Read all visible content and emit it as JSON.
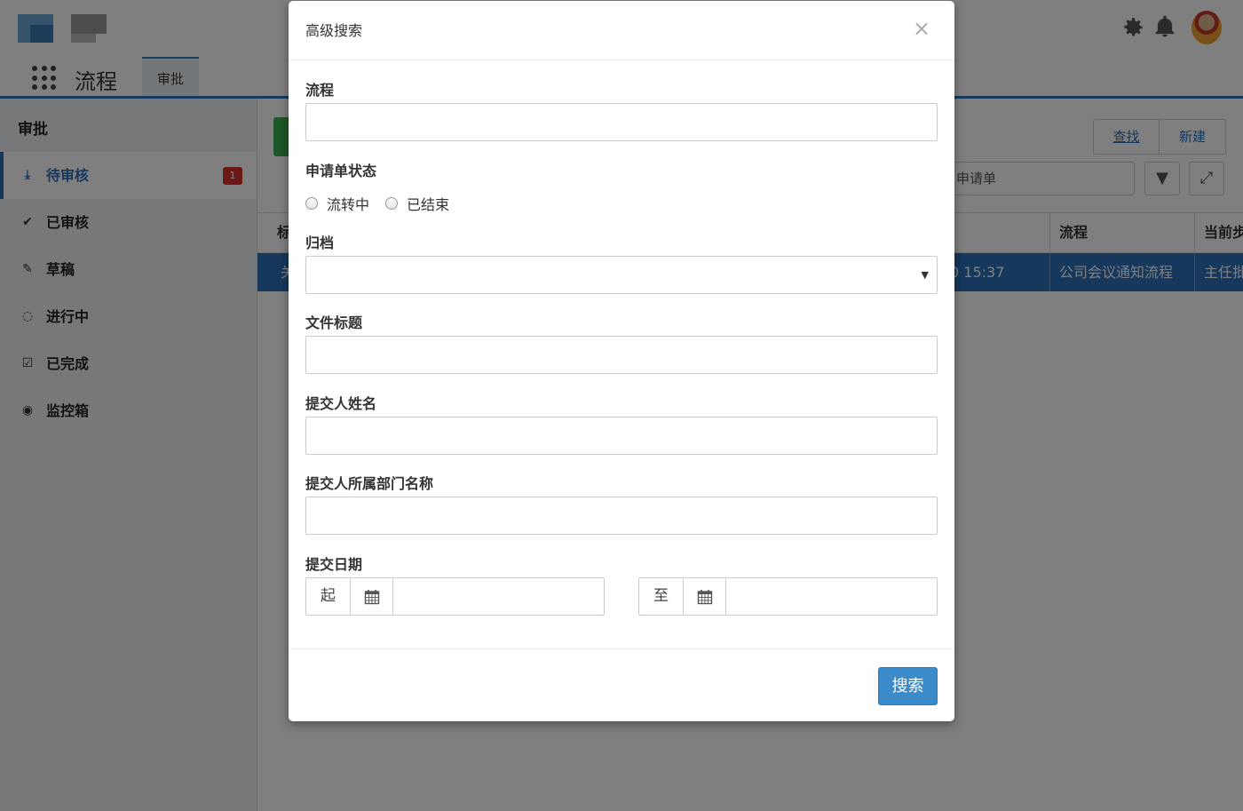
{
  "header": {
    "app_title": "流程",
    "active_tab": "审批"
  },
  "sidebar": {
    "title": "审批",
    "items": [
      {
        "label": "待审核",
        "icon": "inbox-download-icon",
        "badge": "1",
        "active": true
      },
      {
        "label": "已审核",
        "icon": "double-check-icon"
      },
      {
        "label": "草稿",
        "icon": "edit-icon"
      },
      {
        "label": "进行中",
        "icon": "circle-progress-icon"
      },
      {
        "label": "已完成",
        "icon": "checkbox-checked-icon"
      },
      {
        "label": "监控箱",
        "icon": "eye-icon"
      }
    ]
  },
  "main": {
    "find_label": "查找",
    "new_label": "新建",
    "search_fragment": "申请单",
    "columns": {
      "title_fragment": "标",
      "flow": "流程",
      "step_fragment": "当前步"
    },
    "row": {
      "first_fragment": "关",
      "date_fragment": "0 15:37",
      "flow": "公司会议通知流程",
      "step_fragment": "主任批"
    }
  },
  "modal": {
    "title": "高级搜索",
    "close_glyph": "×",
    "fields": {
      "flow_label": "流程",
      "status_label": "申请单状态",
      "status_options": [
        "流转中",
        "已结束"
      ],
      "archive_label": "归档",
      "doc_title_label": "文件标题",
      "submitter_name_label": "提交人姓名",
      "submitter_dept_label": "提交人所属部门名称",
      "submit_date_label": "提交日期",
      "date_from_prefix": "起",
      "date_to_prefix": "至"
    },
    "search_button": "搜索"
  },
  "colors": {
    "accent": "#2b70b8",
    "search_button": "#3b8bcb",
    "badge": "#d9332b",
    "green_button": "#3cae50"
  }
}
